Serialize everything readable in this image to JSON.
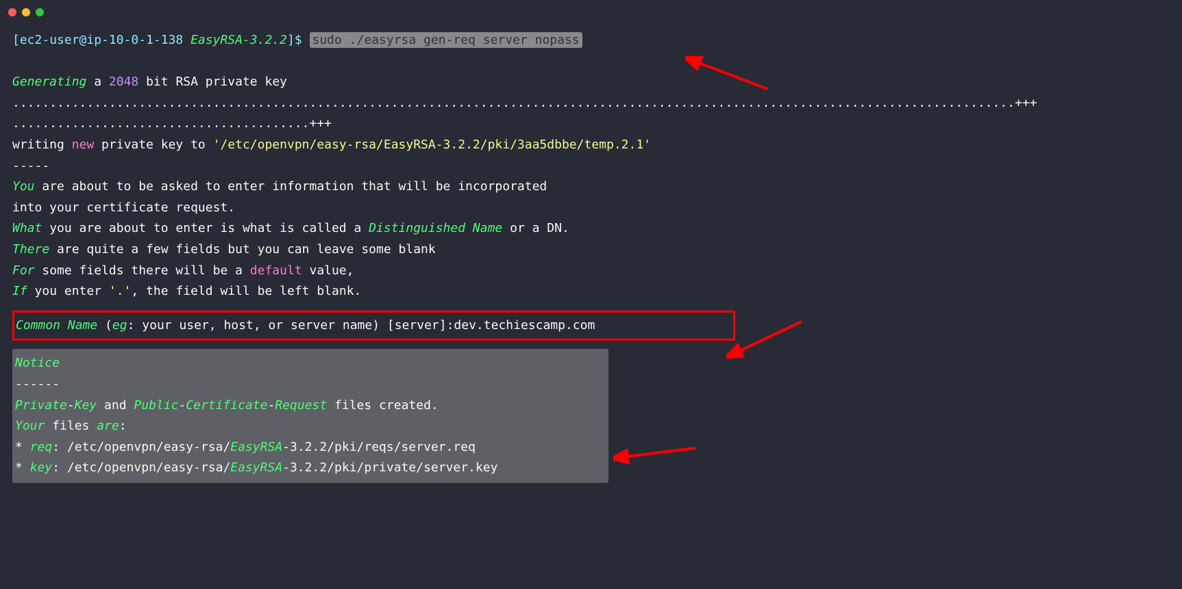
{
  "prompt": {
    "bracket_open": "[",
    "user_host": "ec2-user@ip-10-0-1-138 ",
    "dir": "EasyRSA-3.2.2",
    "bracket_close": "]$ ",
    "cmd": "sudo ./easyrsa gen-req server nopass"
  },
  "gen": {
    "generating": "Generating",
    "a": " a ",
    "bits": "2048",
    "bit": " bit ",
    "rsa": "RSA",
    "pk": " private key"
  },
  "dots1": ".......................................................................................................................................+++",
  "dots2": "........................................+++",
  "writing": {
    "pre": "writing ",
    "new": "new",
    "mid": " private key to ",
    "path_q": "'/etc/openvpn/easy-rsa/EasyRSA-3.2.2/pki/3aa5dbbe/temp.2.1'"
  },
  "dash": "-----",
  "intro": {
    "you": "You",
    "you_rest": " are about to be asked to enter information that will be incorporated",
    "line2": "into your certificate request.",
    "what": "What",
    "what_rest": " you are about to enter is what is called a ",
    "dn": "Distinguished Name",
    "or": " or a ",
    "dn2": "DN",
    "dot": ".",
    "there": "There",
    "there_rest": " are quite a few fields but you can leave some blank",
    "for": "For",
    "for_rest": " some fields there will be a ",
    "default": "default",
    "for_rest2": " value,",
    "if": "If",
    "if_rest": " you enter ",
    "if_dot": "'.'",
    "if_rest2": ", the field will be left blank."
  },
  "cn": {
    "label": "Common Name",
    "space": " (",
    "eg": "eg",
    "rest": ": your user, host, or server name) [server]:dev.techiescamp.com"
  },
  "notice": {
    "title": "Notice",
    "dash": "------",
    "pk": "Private",
    "dash1": "-",
    "key": "Key",
    "and": " and ",
    "pub": "Public",
    "dash2": "-",
    "cert": "Certificate",
    "dash3": "-",
    "req": "Request",
    "files": " files created.",
    "your": "Your",
    "space": " files ",
    "are": "are",
    "colon": ":",
    "star1": "* ",
    "reqlbl": "req",
    "reqpath1": ": /etc/openvpn/easy-rsa/",
    "easy": "EasyRSA",
    "ver": "-3.2.2",
    "reqpath2": "/pki/reqs/server.req",
    "star2": "* ",
    "keylbl": "key",
    "keypath2": "/pki/private/server.key"
  }
}
